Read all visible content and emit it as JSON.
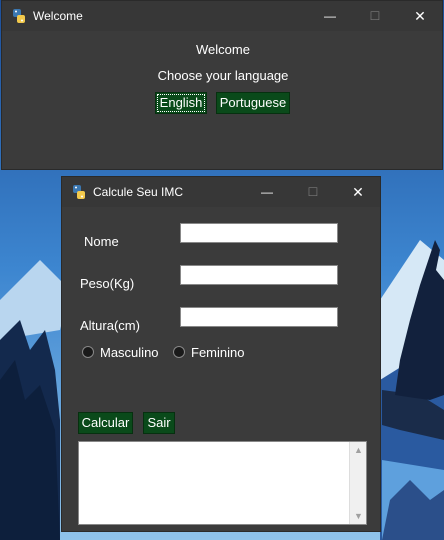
{
  "welcome_window": {
    "title": "Welcome",
    "heading": "Welcome",
    "prompt": "Choose your language",
    "buttons": {
      "english": "English",
      "portuguese": "Portuguese"
    },
    "controls": {
      "minimize": "—",
      "maximize": "☐",
      "close": "✕"
    }
  },
  "imc_window": {
    "title": "Calcule Seu IMC",
    "controls": {
      "minimize": "—",
      "maximize": "☐",
      "close": "✕"
    },
    "fields": {
      "nome_label": "Nome",
      "peso_label": "Peso(Kg)",
      "altura_label": "Altura(cm)",
      "nome_value": "",
      "peso_value": "",
      "altura_value": ""
    },
    "radio": {
      "masculino": "Masculino",
      "feminino": "Feminino"
    },
    "buttons": {
      "calcular": "Calcular",
      "sair": "Sair"
    },
    "scroll": {
      "up": "▲",
      "down": "▼"
    }
  },
  "colors": {
    "window_bg": "#3b3b3b",
    "button_green": "#0a4a1a",
    "desktop_sky": "#2f6bb8"
  },
  "icons": [
    "python-icon"
  ]
}
